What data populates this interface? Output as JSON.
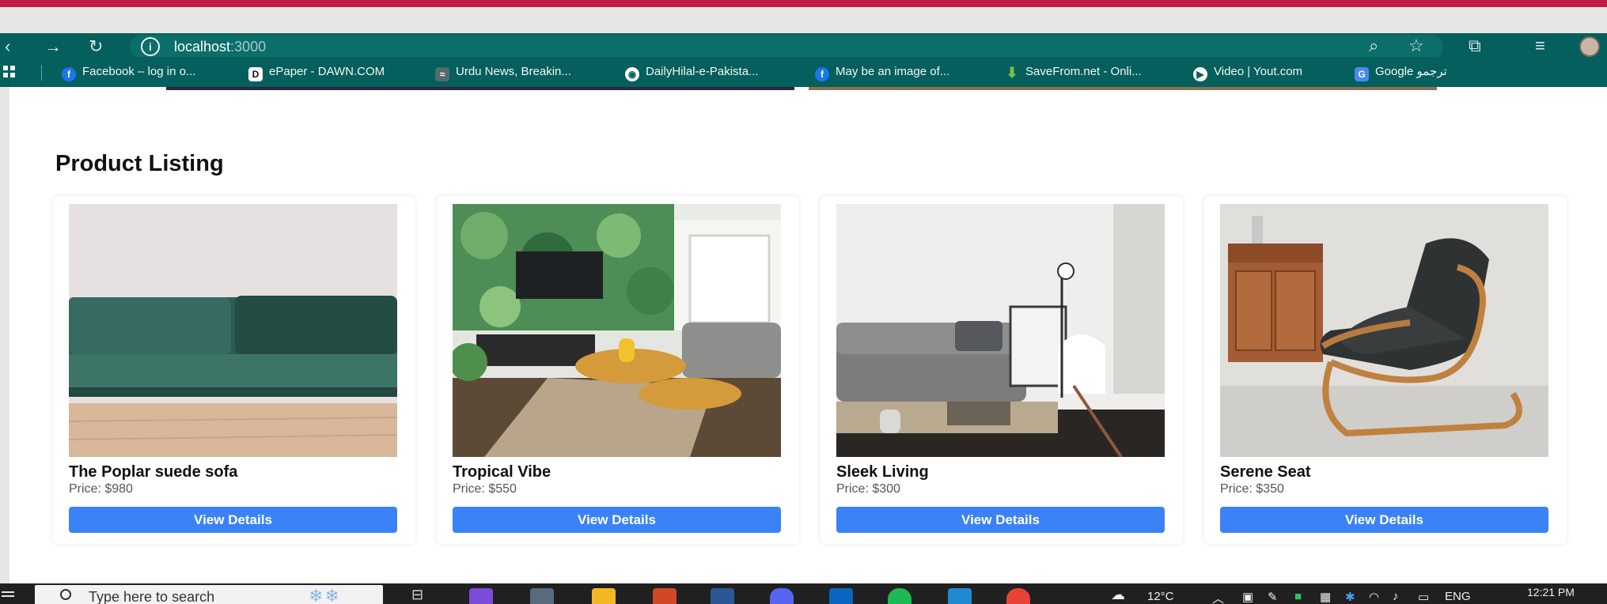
{
  "browser": {
    "url_host": "localhost",
    "url_port": ":3000"
  },
  "bookmarks": [
    {
      "label": "Facebook – log in o...",
      "icon": "facebook-icon",
      "color": "#1877f2",
      "glyph": "f"
    },
    {
      "label": "ePaper - DAWN.COM",
      "icon": "dawn-icon",
      "color": "#ffffff",
      "glyph": "D"
    },
    {
      "label": "Urdu News, Breakin...",
      "icon": "news-icon",
      "color": "#556b6b",
      "glyph": "≈"
    },
    {
      "label": "DailyHilal-e-Pakista...",
      "icon": "globe-icon",
      "color": "#ffffff",
      "glyph": "◉"
    },
    {
      "label": "May be an image of...",
      "icon": "facebook-icon",
      "color": "#1877f2",
      "glyph": "f"
    },
    {
      "label": "SaveFrom.net - Onli...",
      "icon": "download-icon",
      "color": "#7bc043",
      "glyph": "↓"
    },
    {
      "label": "Video | Yout.com",
      "icon": "video-icon",
      "color": "#ffffff",
      "glyph": "Y"
    },
    {
      "label": "Google ترجمو",
      "icon": "translate-icon",
      "color": "#4a89f3",
      "glyph": "G"
    }
  ],
  "main": {
    "section_title": "Product Listing",
    "products": [
      {
        "name": "The Poplar suede sofa",
        "price": "Price: $980",
        "button": "View Details"
      },
      {
        "name": "Tropical Vibe",
        "price": "Price: $550",
        "button": "View Details"
      },
      {
        "name": "Sleek Living",
        "price": "Price: $300",
        "button": "View Details"
      },
      {
        "name": "Serene Seat",
        "price": "Price: $350",
        "button": "View Details"
      }
    ]
  },
  "taskbar": {
    "search_placeholder": "Type here to search",
    "weather": "12°C",
    "language": "ENG",
    "time": "12:21 PM",
    "apps": [
      {
        "name": "copilot-icon",
        "color": "#7a4cd8"
      },
      {
        "name": "camera-icon",
        "color": "#5a6b7d"
      },
      {
        "name": "file-explorer-icon",
        "color": "#f2b824"
      },
      {
        "name": "powerpoint-icon",
        "color": "#d24726"
      },
      {
        "name": "word-icon",
        "color": "#2b5797"
      },
      {
        "name": "discord-icon",
        "color": "#5865f2"
      },
      {
        "name": "linkedin-icon",
        "color": "#0a66c2"
      },
      {
        "name": "spotify-icon",
        "color": "#1db954"
      },
      {
        "name": "vscode-icon",
        "color": "#1f8ad2"
      },
      {
        "name": "chrome-icon",
        "color": "#e94235"
      }
    ]
  },
  "colors": {
    "accent_button": "#3b82f6",
    "browser_chrome": "#055f5c",
    "slide_border": "#c01c43"
  }
}
